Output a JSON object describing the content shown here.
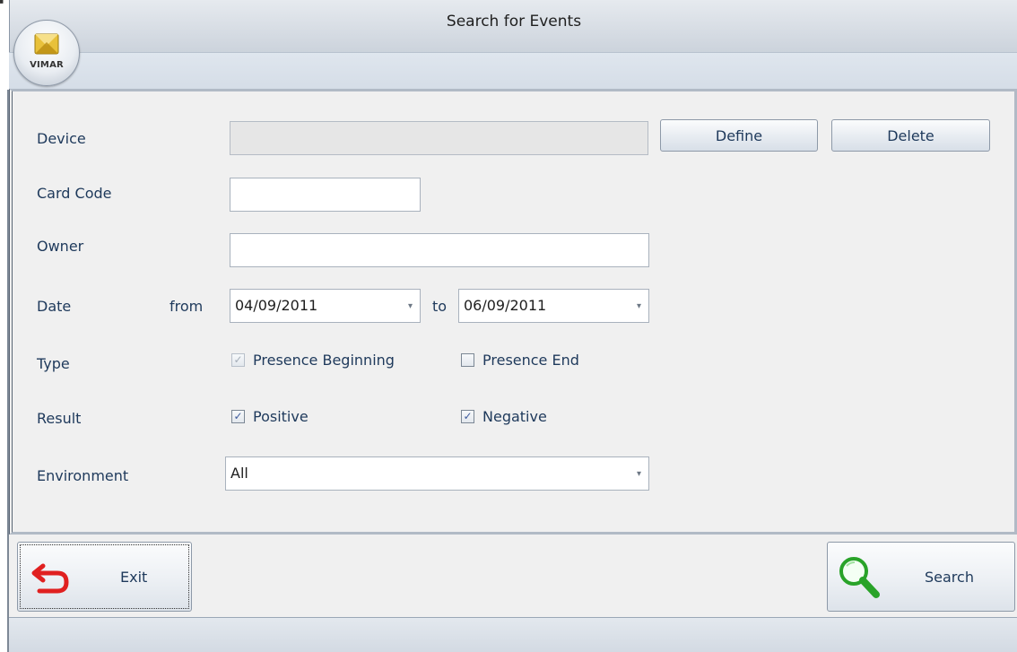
{
  "window": {
    "title": "Search for Events",
    "logo_text": "VIMAR"
  },
  "form": {
    "device": {
      "label": "Device",
      "value": "",
      "define_label": "Define",
      "delete_label": "Delete"
    },
    "card_code": {
      "label": "Card Code",
      "value": ""
    },
    "owner": {
      "label": "Owner",
      "value": ""
    },
    "date": {
      "label": "Date",
      "from_label": "from",
      "from_value": "04/09/2011",
      "to_label": "to",
      "to_value": "06/09/2011"
    },
    "type": {
      "label": "Type",
      "presence_beginning": {
        "label": "Presence Beginning",
        "checked": true,
        "enabled": false
      },
      "presence_end": {
        "label": "Presence End",
        "checked": false,
        "enabled": true
      }
    },
    "result": {
      "label": "Result",
      "positive": {
        "label": "Positive",
        "checked": true
      },
      "negative": {
        "label": "Negative",
        "checked": true
      }
    },
    "environment": {
      "label": "Environment",
      "value": "All"
    }
  },
  "actions": {
    "exit_label": "Exit",
    "search_label": "Search"
  },
  "colors": {
    "label_text": "#1e395b",
    "exit_icon": "#e02020",
    "search_icon": "#29a329"
  },
  "icons": {
    "exit": "undo-arrow-icon",
    "search": "magnifier-icon",
    "dropdown": "chevron-down-icon",
    "check": "checkmark-icon"
  }
}
